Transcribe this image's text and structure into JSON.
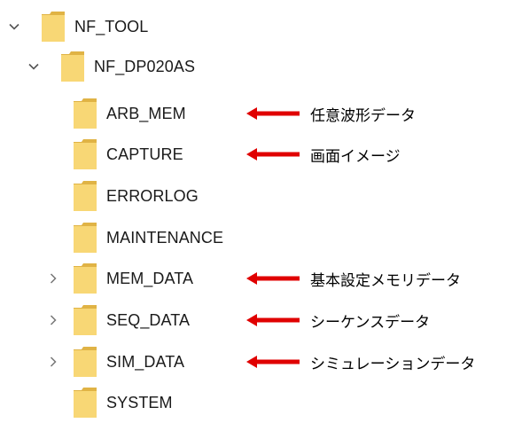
{
  "tree": {
    "root": {
      "name": "NF_TOOL",
      "expanded": true
    },
    "child": {
      "name": "NF_DP020AS",
      "expanded": true
    },
    "items": [
      {
        "name": "ARB_MEM",
        "has_children": false,
        "annotation": "任意波形データ"
      },
      {
        "name": "CAPTURE",
        "has_children": false,
        "annotation": "画面イメージ"
      },
      {
        "name": "ERRORLOG",
        "has_children": false,
        "annotation": ""
      },
      {
        "name": "MAINTENANCE",
        "has_children": false,
        "annotation": ""
      },
      {
        "name": "MEM_DATA",
        "has_children": true,
        "annotation": "基本設定メモリデータ"
      },
      {
        "name": "SEQ_DATA",
        "has_children": true,
        "annotation": "シーケンスデータ"
      },
      {
        "name": "SIM_DATA",
        "has_children": true,
        "annotation": "シミュレーションデータ"
      },
      {
        "name": "SYSTEM",
        "has_children": false,
        "annotation": ""
      }
    ]
  },
  "colors": {
    "folder": "#f8d775",
    "folder_dark": "#e0b345",
    "arrow": "#e00000",
    "chevron": "#555555"
  }
}
